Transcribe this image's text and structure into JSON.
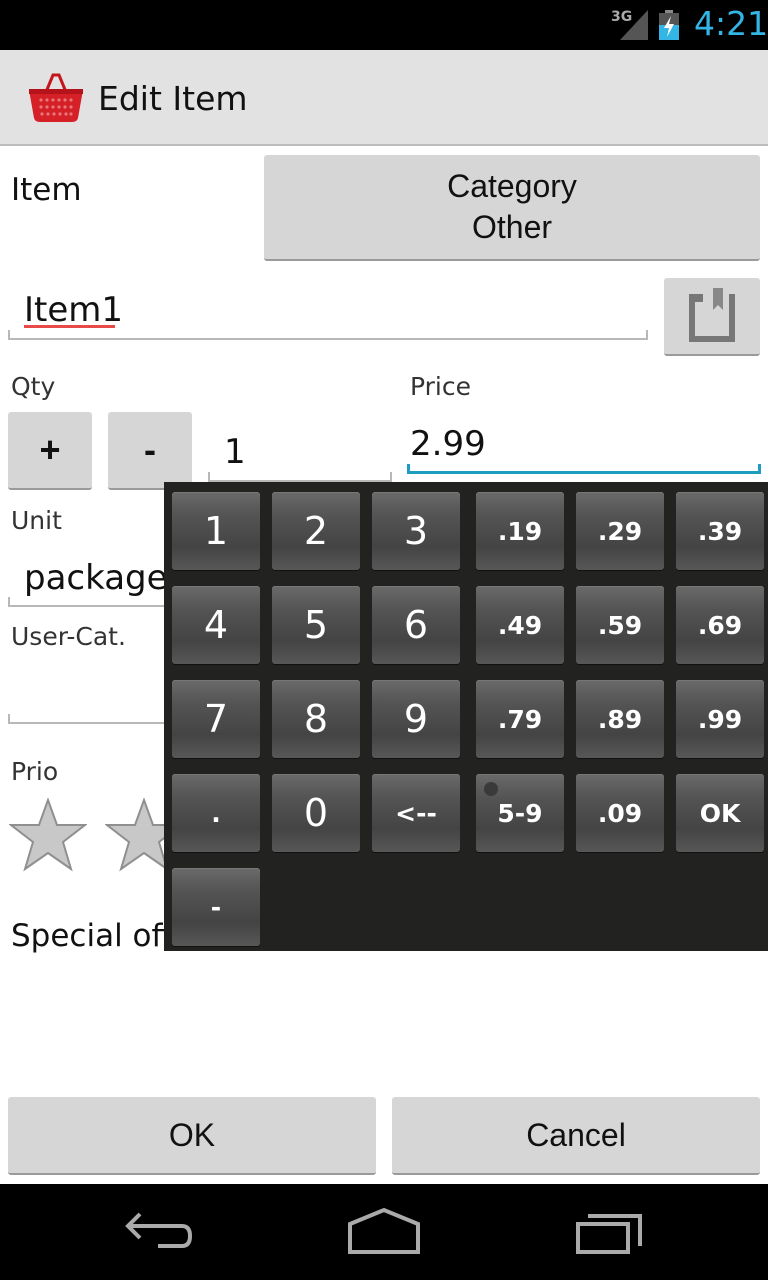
{
  "status_bar": {
    "network": "3G",
    "time": "4:21",
    "clock_color": "#33b5e5"
  },
  "action_bar": {
    "title": "Edit Item",
    "icon": "shopping-basket-icon"
  },
  "form": {
    "item_label": "Item",
    "category_button": {
      "line1": "Category",
      "line2": "Other"
    },
    "item_value": "Item1",
    "qty_label": "Qty",
    "plus_label": "+",
    "minus_label": "-",
    "qty_value": "1",
    "price_label": "Price",
    "price_value": "2.99",
    "unit_label": "Unit",
    "unit_value": "package",
    "usercat_label": "User-Cat.",
    "usercat_value": "",
    "prio_label": "Prio",
    "special_label": "Special off"
  },
  "keypad": {
    "keys": [
      [
        "1",
        "2",
        "3",
        ".19",
        ".29",
        ".39"
      ],
      [
        "4",
        "5",
        "6",
        ".49",
        ".59",
        ".69"
      ],
      [
        "7",
        "8",
        "9",
        ".79",
        ".89",
        ".99"
      ],
      [
        ".",
        "0",
        "<--",
        "5-9",
        ".09",
        "OK"
      ],
      [
        "-"
      ]
    ]
  },
  "buttons": {
    "ok": "OK",
    "cancel": "Cancel"
  },
  "nav_bar": {
    "back": "back-icon",
    "home": "home-icon",
    "recents": "recent-apps-icon"
  },
  "colors": {
    "accent": "#1d9ec0",
    "spellcheck": "#e84a4a",
    "keypad_bg": "#222321"
  }
}
